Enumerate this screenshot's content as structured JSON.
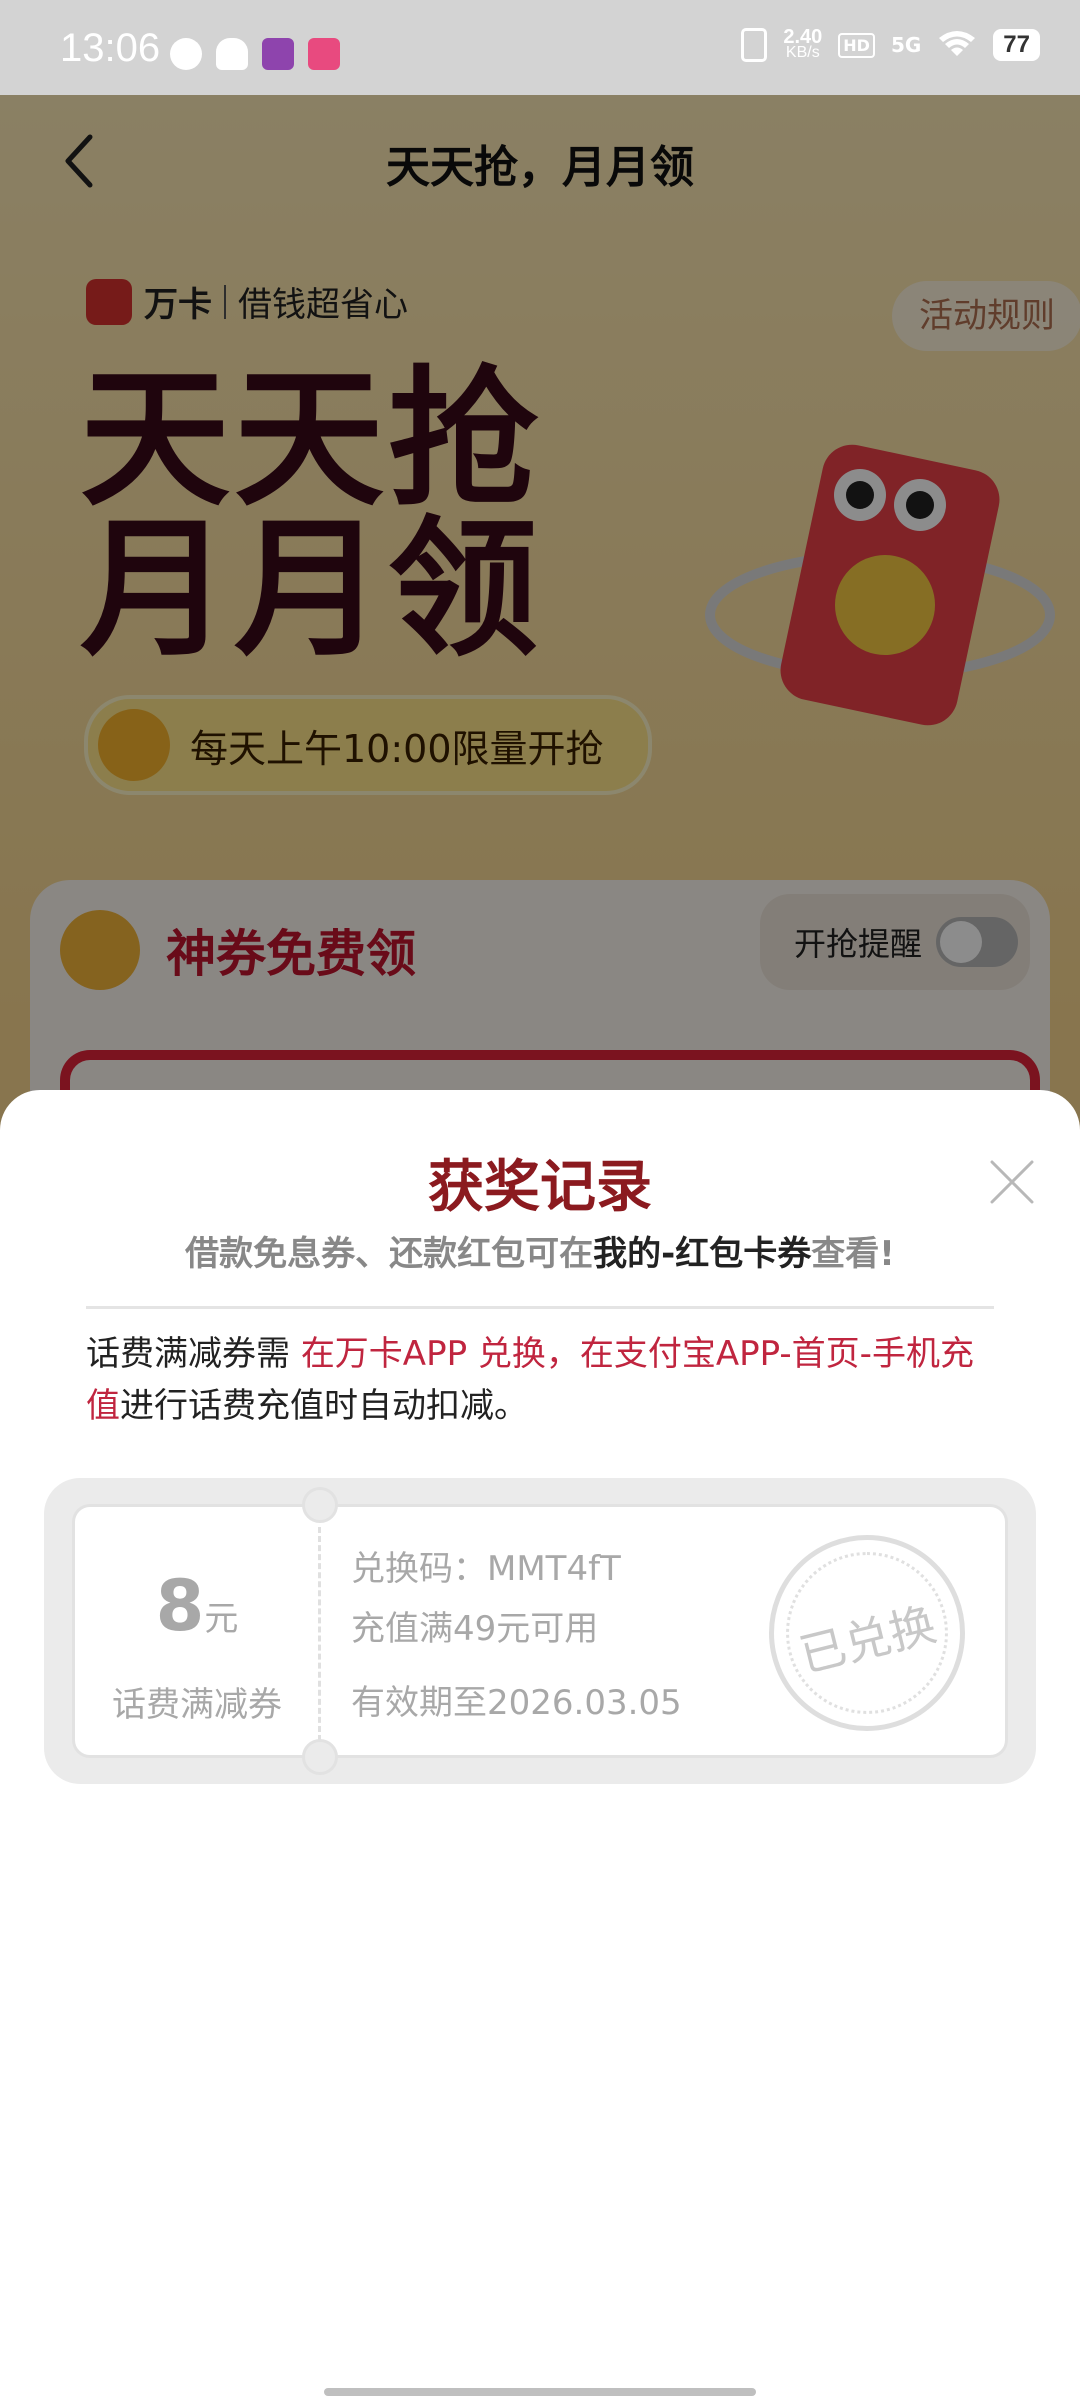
{
  "status_bar": {
    "time": "13:06",
    "net_speed_value": "2.40",
    "net_speed_unit": "KB/s",
    "hd": "HD",
    "signal": "5G",
    "battery": "77"
  },
  "header": {
    "title": "天天抢，月月领"
  },
  "banner": {
    "brand_name": "万卡",
    "brand_slogan": "借钱超省心",
    "rules_button": "活动规则",
    "hero_line1": "天天抢",
    "hero_line2": "月月领",
    "time_notice": "每天上午10:00限量开抢"
  },
  "coupon_section": {
    "title": "神券免费领",
    "remind_label": "开抢提醒",
    "remind_on": false
  },
  "modal": {
    "title": "获奖记录",
    "subtitle_pre": "借款免息券、还款红包可在",
    "subtitle_strong": "我的-红包卡券",
    "subtitle_post": "查看!",
    "note_pre": "话费满减券需 ",
    "note_red": "在万卡APP 兑换，在支付宝APP-首页-手机充值",
    "note_post": "进行话费充值时自动扣减。",
    "coupon": {
      "amount": "8",
      "unit": "元",
      "type": "话费满减券",
      "code_line": "兑换码：MMT4fT",
      "condition": "充值满49元可用",
      "validity": "有效期至2026.03.05",
      "stamp": "已兑换"
    }
  },
  "colors": {
    "title_red": "#8b1a1f",
    "accent_red": "#c0253f",
    "disabled_gray": "#a8a8a8"
  }
}
